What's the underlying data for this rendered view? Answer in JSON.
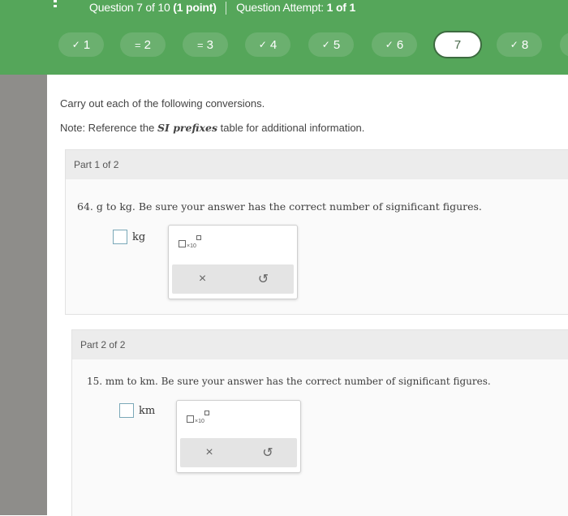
{
  "header": {
    "question": "Question 7 of 10",
    "points": "(1 point)",
    "attempt_label": "Question Attempt:",
    "attempt_value": "1 of 1"
  },
  "nav": [
    {
      "label": "1",
      "mark": "✓",
      "state": "done"
    },
    {
      "label": "2",
      "mark": "=",
      "state": "partial"
    },
    {
      "label": "3",
      "mark": "=",
      "state": "partial"
    },
    {
      "label": "4",
      "mark": "✓",
      "state": "done"
    },
    {
      "label": "5",
      "mark": "✓",
      "state": "done"
    },
    {
      "label": "6",
      "mark": "✓",
      "state": "done"
    },
    {
      "label": "7",
      "mark": "",
      "state": "current"
    },
    {
      "label": "8",
      "mark": "✓",
      "state": "done"
    }
  ],
  "instructions": "Carry out each of the following conversions.",
  "note": {
    "prefix": "Note: Reference the ",
    "emphasis": "SI prefixes",
    "suffix": " table for additional information."
  },
  "part1": {
    "label": "Part 1 of 2",
    "question": "64. g to kg. Be sure your answer has the correct number of significant figures.",
    "unit": "kg",
    "x10": "×10"
  },
  "part2": {
    "label": "Part 2 of 2",
    "question": "15. mm to km. Be sure your answer has the correct number of significant figures.",
    "unit": "km",
    "x10": "×10"
  },
  "tools": {
    "clear": "×",
    "undo": "↺"
  },
  "colors": {
    "topbar": "#55a65a",
    "pill": "#6bb06f",
    "current_border": "#3d6b40"
  }
}
